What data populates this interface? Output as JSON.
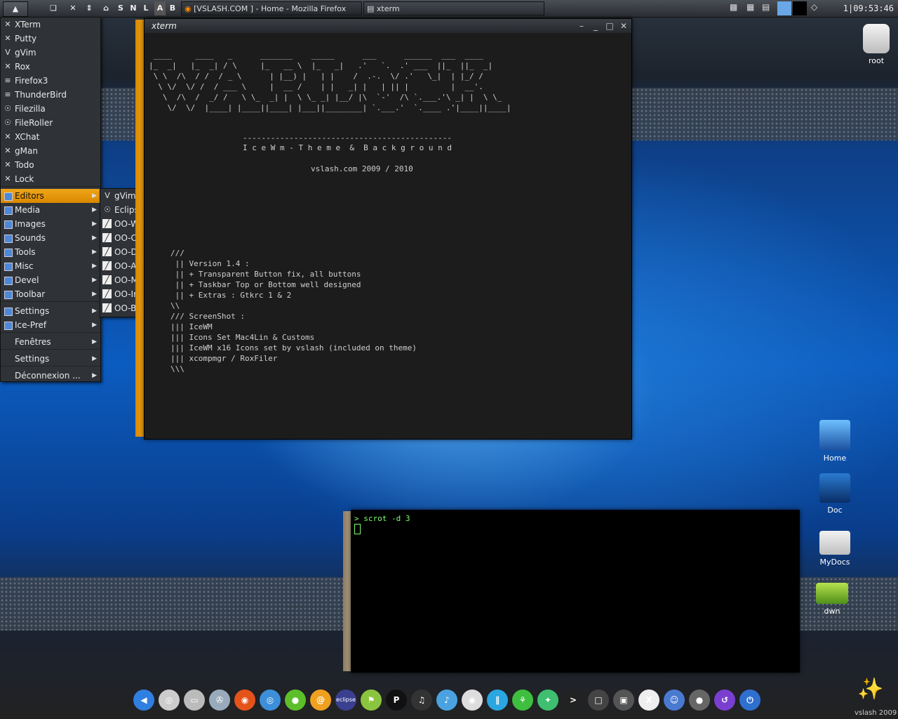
{
  "taskbar": {
    "quick_labels": [
      "S",
      "N",
      "L",
      "A",
      "B"
    ],
    "tasks": [
      {
        "title": "[VSLASH.COM ] - Home - Mozilla Firefox"
      },
      {
        "title": "xterm"
      }
    ],
    "clock": "1|09:53:46"
  },
  "main_menu": {
    "apps": [
      "XTerm",
      "Putty",
      "gVim",
      "Rox",
      "Firefox3",
      "ThunderBird",
      "Filezilla",
      "FileRoller",
      "XChat",
      "gMan",
      "Todo",
      "Lock"
    ],
    "categories": [
      "Editors",
      "Media",
      "Images",
      "Sounds",
      "Tools",
      "Misc",
      "Devel",
      "Toolbar"
    ],
    "prefs": [
      "Settings",
      "Ice-Pref"
    ],
    "system": [
      "Fenêtres",
      "Settings",
      "Déconnexion ..."
    ]
  },
  "editors_menu": {
    "items": [
      "gVim",
      "Eclipse",
      "OO-Word",
      "OO-Calc",
      "OO-Draw",
      "OO-Admin",
      "OO-Math",
      "OO-Impress",
      "OO-Base"
    ]
  },
  "xterm_main": {
    "title": "xterm",
    "ascii_art": " ____     ____   _      _______    _____      ___      ______  ___  ____\n|_  _|   |_  _| / \\     |_   __ \\  |_   _|   .'   `.  .' ___  ||_  ||_  _|\n \\ \\  /\\  / /  / _ \\      | |__) |   | |    /  .-.  \\/ .'   \\_|  | |_/ /\n  \\ \\/  \\/ /  / ___ \\     |  __ /    | |   _| |   | || |         |  __'.\n   \\  /\\  /  _/ /   \\ \\_  _| |  \\ \\_ _| |__/ |\\  `-'  /\\ `.___.'\\ _| |  \\ \\_\n    \\/  \\/  |____| |____||____| |___||________| `.___.'  `.____ .'|____||____|",
    "divider": "---------------------------------------------",
    "subtitle": "I c e W m - T h e m e  &  B a c k g r o u n d",
    "byline": "vslash.com 2009 / 2010",
    "notes": "///\n || Version 1.4 :\n || + Transparent Button fix, all buttons\n || + Taskbar Top or Bottom well designed\n || + Extras : Gtkrc 1 & 2\n\\\\\n/// ScreenShot :\n||| IceWM\n||| Icons Set Mac4Lin & Customs\n||| IceWM x16 Icons set by vslash (included on theme)\n||| xcompmgr / RoxFiler\n\\\\\\"
  },
  "xterm_small": {
    "prompt": "> scrot -d 3"
  },
  "desktop_icons": [
    "root",
    "Home",
    "Doc",
    "MyDocs",
    "dwn"
  ],
  "watermark": "vslash  2009",
  "dock": {
    "items": [
      "send-icon",
      "cd-icon",
      "drive-icon",
      "usb-icon",
      "firefox-icon",
      "network-icon",
      "chat-icon",
      "mail-icon",
      "eclipse-icon",
      "android-icon",
      "pidgin-icon",
      "music-icon",
      "itunes-icon",
      "video-icon",
      "books-icon",
      "tree-icon",
      "puzzle-icon",
      "terminal-icon",
      "screen-icon",
      "monitor-icon",
      "x11-icon",
      "finder-icon",
      "speaker-icon",
      "logout-icon",
      "power-icon"
    ],
    "eclipse_label": "eclipse"
  }
}
